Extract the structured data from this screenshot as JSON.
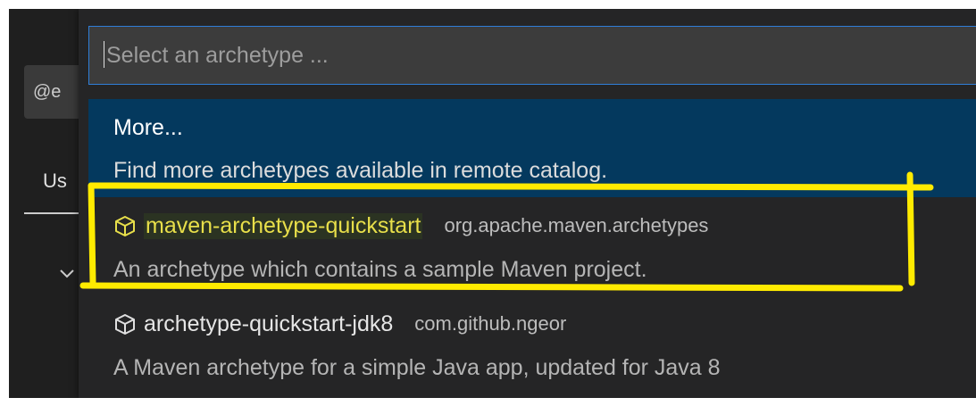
{
  "left_panel": {
    "search_chip_text": "@e",
    "tab_label": "Us",
    "chevron_icon": "chevron-down-icon"
  },
  "quick_pick": {
    "input_placeholder": "Select an archetype ...",
    "items": [
      {
        "title": "More...",
        "description": "Find more archetypes available in remote catalog.",
        "selected": true
      },
      {
        "icon": "package-cube-icon",
        "name": "maven-archetype-quickstart",
        "group": "org.apache.maven.archetypes",
        "description": "An archetype which contains a sample Maven project.",
        "highlighted": true
      },
      {
        "icon": "package-cube-icon",
        "name": "archetype-quickstart-jdk8",
        "group": "com.github.ngeor",
        "description": "A Maven archetype for a simple Java app, updated for Java 8"
      }
    ]
  },
  "colors": {
    "background": "#1e1e1e",
    "quickpick_bg": "#252526",
    "selected_bg": "#04395e",
    "input_border": "#2f7ed8",
    "highlight_text": "#e8df4a",
    "annotation": "#ffeb00"
  }
}
